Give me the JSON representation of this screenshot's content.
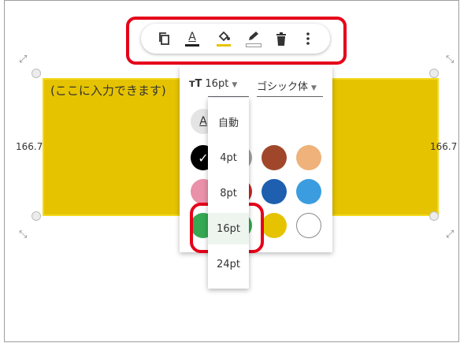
{
  "shape": {
    "text": "(ここに入力できます)",
    "width_label": "166.7",
    "height_label": "166.7",
    "fill_color": "#e6c300"
  },
  "toolbar": {
    "icons": [
      "copy-icon",
      "text-color-icon",
      "fill-color-icon",
      "border-color-icon",
      "delete-icon",
      "more-vert-icon"
    ],
    "text_color_letter": "A",
    "text_color_swatch": "#222222",
    "fill_swatch": "#e6c300",
    "border_swatch": "#ffffff"
  },
  "format_panel": {
    "font_size_icon": "тT",
    "font_size_value": "16pt",
    "font_family_value": "ゴシック体",
    "auto_color_letter": "A",
    "colors": [
      "#000000",
      "#a0a0a0",
      "#a0472b",
      "#eeb27a",
      "#e991a9",
      "#c62828",
      "#1e5fb0",
      "#3b9de0",
      "#35a853",
      "#35a853",
      "#e6c300",
      "#ffffff"
    ],
    "selected_color_index": 0
  },
  "font_size_dropdown": {
    "options": [
      "自動",
      "4pt",
      "8pt",
      "16pt",
      "24pt"
    ],
    "selected": "16pt"
  },
  "highlight_color": "#e50019"
}
